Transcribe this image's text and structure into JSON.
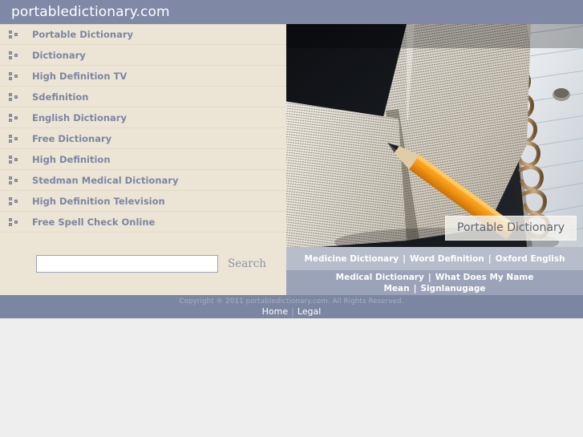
{
  "site": {
    "title": "portabledictionary.com"
  },
  "sidebar": {
    "items": [
      {
        "label": "Portable Dictionary",
        "icon": "bullet-squares-icon"
      },
      {
        "label": "Dictionary",
        "icon": "bullet-squares-icon"
      },
      {
        "label": "High Definition TV",
        "icon": "bullet-squares-icon"
      },
      {
        "label": "Sdefinition",
        "icon": "bullet-squares-icon"
      },
      {
        "label": "English Dictionary",
        "icon": "bullet-squares-icon"
      },
      {
        "label": "Free Dictionary",
        "icon": "bullet-squares-icon"
      },
      {
        "label": "High Definition",
        "icon": "bullet-squares-icon"
      },
      {
        "label": "Stedman Medical Dictionary",
        "icon": "bullet-squares-icon"
      },
      {
        "label": "High Definition Television",
        "icon": "bullet-squares-icon"
      },
      {
        "label": "Free Spell Check Online",
        "icon": "bullet-squares-icon"
      }
    ]
  },
  "search": {
    "value": "",
    "placeholder": "",
    "button_label": "Search"
  },
  "hero": {
    "caption": "Portable Dictionary",
    "alt": "open dictionary page with orange pencil and spiral notebook"
  },
  "link_bands": {
    "row1": [
      {
        "label": "Medicine Dictionary"
      },
      {
        "label": "Word Definition"
      },
      {
        "label": "Oxford English"
      }
    ],
    "row2_line1": [
      {
        "label": "Medical Dictionary"
      },
      {
        "label": "What Does My Name"
      }
    ],
    "row2_line2": [
      {
        "label": "Mean"
      },
      {
        "label": "Signlanugage"
      }
    ],
    "separator": "|"
  },
  "footer": {
    "copyright": "Copyright ® 2011 portabledictionary.com. All Rights Reserved.",
    "links": [
      {
        "label": "Home"
      },
      {
        "label": "Legal"
      }
    ],
    "separator": "|"
  },
  "colors": {
    "header_bar": "#7f89a5",
    "sidebar_bg": "#ece5d6",
    "sidebar_text": "#7c86a2",
    "band_light": "#b8bdcb",
    "band_medium": "#9ba3b9",
    "footer_bar": "#7b86a0",
    "page_bg": "#eeeeee"
  }
}
